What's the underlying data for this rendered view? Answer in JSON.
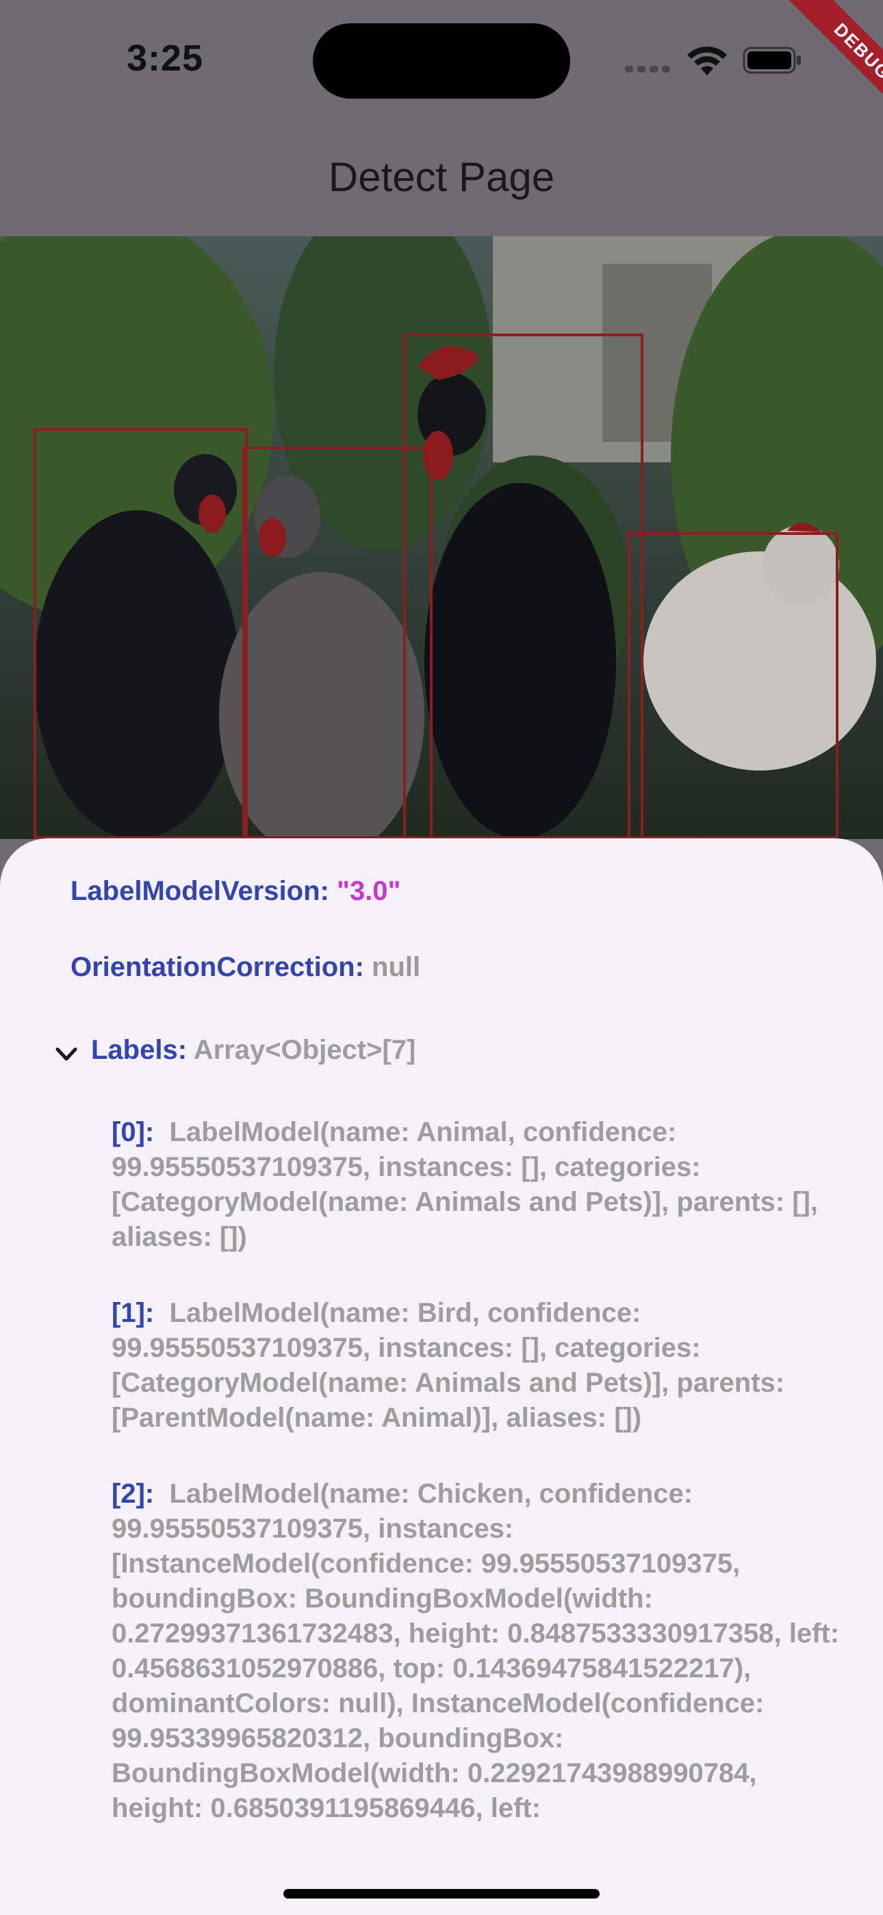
{
  "status_bar": {
    "time": "3:25",
    "debug_label": "DEBUG"
  },
  "app_bar": {
    "title": "Detect Page"
  },
  "image": {
    "description_icon": "photo-of-chickens",
    "detections": 4
  },
  "result": {
    "label_model_version_key": "LabelModelVersion:",
    "label_model_version_value": "\"3.0\"",
    "orientation_key": "OrientationCorrection:",
    "orientation_value": "null",
    "labels_key": "Labels:",
    "labels_type": "Array<Object>[7]",
    "items": [
      {
        "index": "[0]:",
        "text": "LabelModel(name: Animal, confidence: 99.95550537109375, instances: [], categories: [CategoryModel(name: Animals and Pets)], parents: [], aliases: [])"
      },
      {
        "index": "[1]:",
        "text": "LabelModel(name: Bird, confidence: 99.95550537109375, instances: [], categories: [CategoryModel(name: Animals and Pets)], parents: [ParentModel(name: Animal)], aliases: [])"
      },
      {
        "index": "[2]:",
        "text": "LabelModel(name: Chicken, confidence: 99.95550537109375, instances: [InstanceModel(confidence: 99.95550537109375, boundingBox: BoundingBoxModel(width: 0.2729937136173248​3, height: 0.8487533330917358, left: 0.4568631052970886, top: 0.14369475841522217), dominantColors: null), InstanceModel(confidence: 99.95339965820312, boundingBox: BoundingBoxModel(width: 0.22921743988990784, height: 0.6850391195869446, left:"
      }
    ]
  }
}
